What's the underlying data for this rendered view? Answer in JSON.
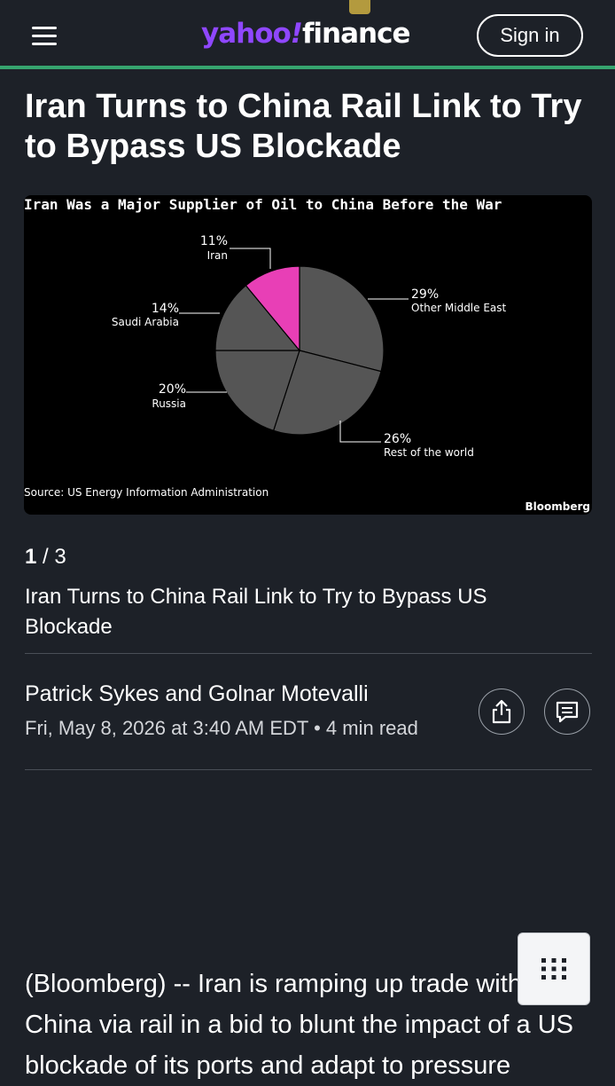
{
  "header": {
    "logo_yahoo": "yahoo",
    "logo_bang": "!",
    "logo_finance": "finance",
    "signin_label": "Sign in",
    "accent_color": "#36a56f",
    "brand_color": "#8f47ff"
  },
  "article": {
    "headline": "Iran Turns to China Rail Link to Try to Bypass US Blockade",
    "gallery": {
      "current": "1",
      "separator": " / ",
      "total": "3",
      "caption": "Iran Turns to China Rail Link to Try to Bypass US Blockade"
    },
    "byline": {
      "authors": "Patrick Sykes and Golnar Motevalli",
      "date": "Fri, May 8, 2026 at 3:40 AM EDT",
      "separator": " • ",
      "read_time": "4 min read"
    },
    "body_intro": "(Bloomberg) -- Iran is ramping up trade with China via rail in a bid to blunt the impact of a US blockade of its ports and adapt to pressure"
  },
  "icons": {
    "menu": "hamburger-menu-icon",
    "share": "share-icon",
    "comments": "comment-icon",
    "grid": "grid-dots-icon"
  },
  "chart_data": {
    "type": "pie",
    "title": "Iran Was a Major Supplier of Oil to China Before the War",
    "source": "Source: US Energy Information Administration",
    "brand": "Bloomberg",
    "slices": [
      {
        "label": "Other Middle East",
        "pct_label": "29%",
        "value": 29,
        "color": "#555555"
      },
      {
        "label": "Rest of the world",
        "pct_label": "26%",
        "value": 26,
        "color": "#555555"
      },
      {
        "label": "Russia",
        "pct_label": "20%",
        "value": 20,
        "color": "#555555"
      },
      {
        "label": "Saudi Arabia",
        "pct_label": "14%",
        "value": 14,
        "color": "#555555"
      },
      {
        "label": "Iran",
        "pct_label": "11%",
        "value": 11,
        "color": "#e83fb6"
      }
    ]
  }
}
